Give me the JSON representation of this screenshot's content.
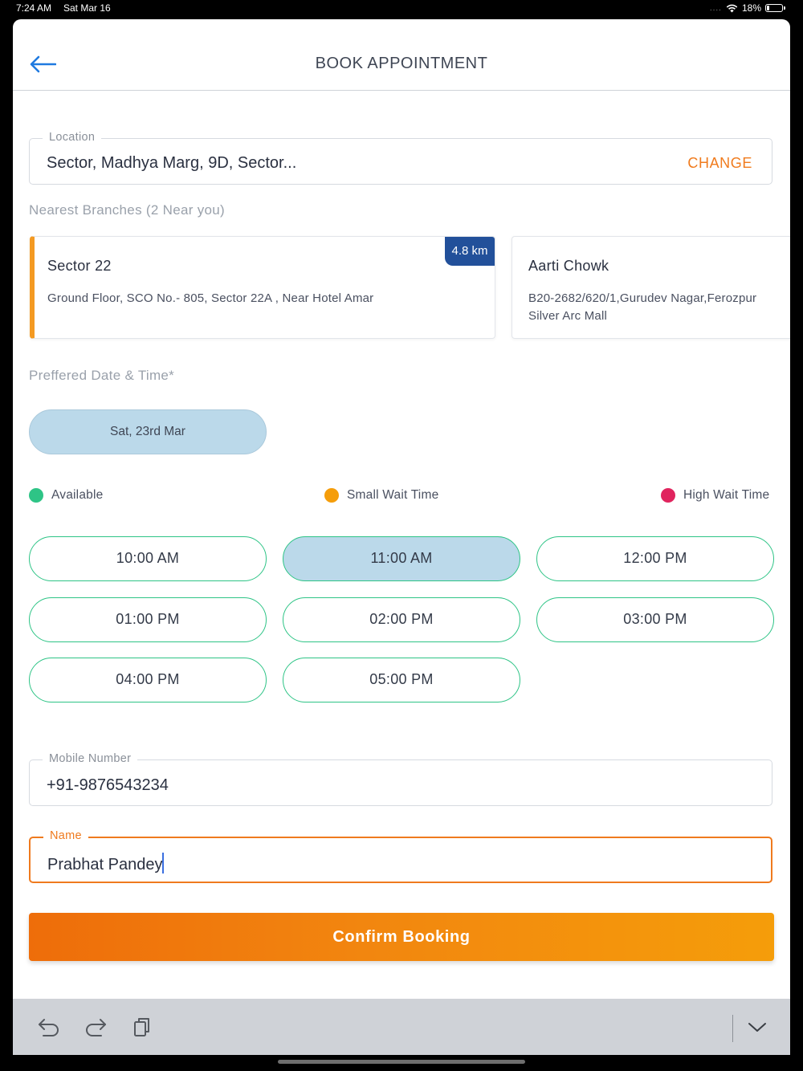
{
  "status_bar": {
    "time": "7:24 AM",
    "date": "Sat Mar 16",
    "signal": "....",
    "battery": "18%"
  },
  "header": {
    "title": "BOOK APPOINTMENT"
  },
  "location": {
    "label": "Location",
    "value": "Sector, Madhya Marg, 9D, Sector...",
    "change_label": "CHANGE"
  },
  "branches": {
    "heading": "Nearest Branches (2 Near you)",
    "items": [
      {
        "name": "Sector 22",
        "address": "Ground Floor, SCO No.- 805, Sector 22A , Near Hotel Amar",
        "distance": "4.8 km",
        "selected": true
      },
      {
        "name": "Aarti Chowk",
        "address": "B20-2682/620/1,Gurudev Nagar,Ferozpur Silver Arc Mall",
        "selected": false
      }
    ]
  },
  "datetime": {
    "heading": "Preffered Date & Time*",
    "selected_date": "Sat, 23rd Mar"
  },
  "legend": [
    {
      "label": "Available",
      "color": "#2ec486"
    },
    {
      "label": "Small Wait Time",
      "color": "#f59d0a"
    },
    {
      "label": "High Wait Time",
      "color": "#e0245e"
    }
  ],
  "time_slots": [
    {
      "label": "10:00 AM",
      "selected": false
    },
    {
      "label": "11:00 AM",
      "selected": true
    },
    {
      "label": "12:00 PM",
      "selected": false
    },
    {
      "label": "01:00 PM",
      "selected": false
    },
    {
      "label": "02:00 PM",
      "selected": false
    },
    {
      "label": "03:00 PM",
      "selected": false
    },
    {
      "label": "04:00 PM",
      "selected": false
    },
    {
      "label": "05:00 PM",
      "selected": false
    }
  ],
  "mobile": {
    "label": "Mobile Number",
    "value": "+91-9876543234"
  },
  "name_field": {
    "label": "Name",
    "value": "Prabhat Pandey"
  },
  "confirm": {
    "label": "Confirm Booking"
  },
  "keyboard_bar": {
    "undo": "undo-icon",
    "redo": "redo-icon",
    "paste": "paste-icon",
    "dismiss": "chevron-down-icon"
  }
}
